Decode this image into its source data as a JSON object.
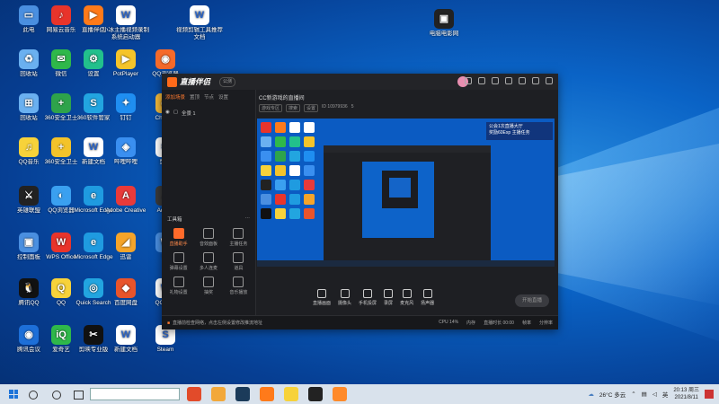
{
  "desktop": {
    "icons": [
      {
        "label": "此电",
        "color": "#4a8fe0",
        "glyph": "▭"
      },
      {
        "label": "网易云音乐",
        "color": "#e8342b",
        "glyph": "♪"
      },
      {
        "label": "直播伴侣",
        "color": "#ff7a1a",
        "glyph": "▶"
      },
      {
        "label": "小冰主播视频录制系统启动器",
        "color": "#ffffff",
        "glyph": "W"
      },
      {
        "label": "视频剪辑工具推荐文档",
        "color": "#ffffff",
        "glyph": "W"
      },
      {
        "label": "回收站",
        "color": "#6ab0f0",
        "glyph": "♻"
      },
      {
        "label": "微信",
        "color": "#2fb84a",
        "glyph": "✉"
      },
      {
        "label": "设置",
        "color": "#22c08c",
        "glyph": "⚙"
      },
      {
        "label": "PotPlayer",
        "color": "#f5c42a",
        "glyph": "▶"
      },
      {
        "label": "QQ浏览器",
        "color": "#f56a2a",
        "glyph": "◉"
      },
      {
        "label": "回收站",
        "color": "#6ab0f0",
        "glyph": "⊞"
      },
      {
        "label": "360安全卫士",
        "color": "#2ea34b",
        "glyph": "+"
      },
      {
        "label": "360软件管家",
        "color": "#22a5e0",
        "glyph": "S"
      },
      {
        "label": "钉钉",
        "color": "#1f8ef1",
        "glyph": "✦"
      },
      {
        "label": "Chrome",
        "color": "#f2b83a",
        "glyph": "◎"
      },
      {
        "label": "QQ音乐",
        "color": "#f7d23a",
        "glyph": "♫"
      },
      {
        "label": "360安全卫士",
        "color": "#f3c32a",
        "glyph": "+"
      },
      {
        "label": "新建文档",
        "color": "#ffffff",
        "glyph": "W"
      },
      {
        "label": "哔哩哔哩",
        "color": "#3a8ff0",
        "glyph": "◈"
      },
      {
        "label": "剪映",
        "color": "#ffffff",
        "glyph": "✂"
      },
      {
        "label": "英雄联盟",
        "color": "#222222",
        "glyph": "⚔"
      },
      {
        "label": "QQ浏览器",
        "color": "#3aa0f0",
        "glyph": "◐"
      },
      {
        "label": "Microsoft Edge",
        "color": "#1f9be0",
        "glyph": "e"
      },
      {
        "label": "Adobe Creative",
        "color": "#e83a3a",
        "glyph": "A"
      },
      {
        "label": "Adobe",
        "color": "#3a3a3a",
        "glyph": "A"
      },
      {
        "label": "控制面板",
        "color": "#4a8fe0",
        "glyph": "▣"
      },
      {
        "label": "WPS Office",
        "color": "#e8342b",
        "glyph": "W"
      },
      {
        "label": "Microsoft Edge",
        "color": "#1f9be0",
        "glyph": "e"
      },
      {
        "label": "迅雷",
        "color": "#f5a42a",
        "glyph": "◢"
      },
      {
        "label": "Wi",
        "color": "#4a8fe0",
        "glyph": "W"
      },
      {
        "label": "腾讯QQ",
        "color": "#111111",
        "glyph": "🐧"
      },
      {
        "label": "QQ",
        "color": "#f7d23a",
        "glyph": "Q"
      },
      {
        "label": "Quick Search",
        "color": "#22a5e0",
        "glyph": "◎"
      },
      {
        "label": "百度网盘",
        "color": "#e8542b",
        "glyph": "◆"
      },
      {
        "label": "QQ游戏",
        "color": "#ffffff",
        "glyph": "W"
      },
      {
        "label": "腾讯会议",
        "color": "#1d6fd8",
        "glyph": "◉"
      },
      {
        "label": "爱奇艺",
        "color": "#2fb84a",
        "glyph": "iQ"
      },
      {
        "label": "剪映专业版",
        "color": "#111111",
        "glyph": "✂"
      },
      {
        "label": "新建文档",
        "color": "#ffffff",
        "glyph": "W"
      },
      {
        "label": "Steam",
        "color": "#ffffff",
        "glyph": "S"
      }
    ],
    "top_right_icon": {
      "label": "电脑电影网",
      "color": "#222222"
    }
  },
  "app": {
    "name": "直播伴侣",
    "version": "公测",
    "left_tabs": [
      "添加场景",
      "置顶",
      "节点",
      "设置"
    ],
    "scene_label": "全景 1",
    "tools_header": "工具箱",
    "tools": [
      "直播助手",
      "音效面板",
      "主播任务",
      "弹幕设置",
      "多人连麦",
      "道具",
      "礼物设置",
      "抽奖",
      "音乐播放"
    ],
    "room_title": "CC新游戏的直播间",
    "room_meta": [
      "游戏专区",
      "搜索",
      "设置",
      "ID 10979936",
      "5"
    ],
    "preview_banner": "公会1次直播大厅\n奖励60Exp 主播任务",
    "controls": [
      "直播画面",
      "摄像头",
      "手机投屏",
      "录屏",
      "麦克风",
      "扬声器"
    ],
    "go_live": "开始直播",
    "status_warning": "直播前检查网络，点击左侧设置修改推流地址",
    "status_right": [
      "CPU 14%",
      "内存",
      "直播时长 00:00",
      "帧率",
      "分辨率"
    ]
  },
  "taskbar": {
    "weather": "26°C 多云",
    "time": "20:13 周三",
    "date": "2021/8/11",
    "apps": [
      {
        "name": "browser-icon",
        "color": "#e24b2a"
      },
      {
        "name": "media-icon",
        "color": "#f2a83a"
      },
      {
        "name": "steam-icon",
        "color": "#1b3b5a"
      },
      {
        "name": "live-companion-icon",
        "color": "#ff7a1a"
      },
      {
        "name": "qq-music-icon",
        "color": "#f7d23a"
      },
      {
        "name": "app-icon",
        "color": "#222"
      },
      {
        "name": "live-app-icon",
        "color": "#ff8a2a"
      }
    ]
  }
}
